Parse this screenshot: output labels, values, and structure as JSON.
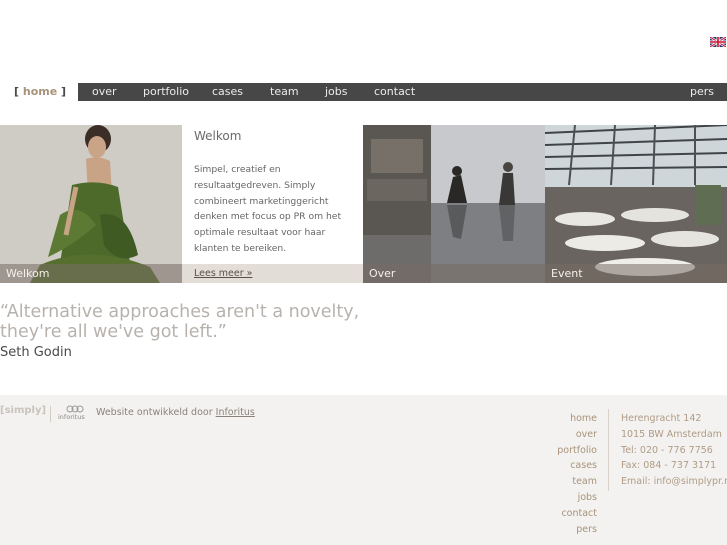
{
  "header": {
    "flag_icon": "uk-flag-icon"
  },
  "nav": {
    "home_bracket_open": "[",
    "home": "home",
    "home_bracket_close": "]",
    "items": [
      "over",
      "portfolio",
      "cases",
      "team",
      "jobs",
      "contact"
    ],
    "pers": "pers"
  },
  "panels": {
    "welkom_caption": "Welkom",
    "welkom_title": "Welkom",
    "welkom_text": "Simpel, creatief en resultaatgedreven. Simply combineert marketinggericht denken met focus op PR om het optimale resultaat voor haar klanten te bereiken.",
    "lees_meer": "Lees meer »",
    "over_caption": "Over",
    "event_caption": "Event"
  },
  "quote": {
    "line1": "“Alternative approaches aren't a novelty,",
    "line2": "they're all we've got left.”",
    "author": "Seth Godin"
  },
  "footer": {
    "logo": "[simply]",
    "inforitus_logo": "inforitus",
    "credit": "Website ontwikkeld door ",
    "credit_link": "Inforitus",
    "nav": [
      "home",
      "over",
      "portfolio",
      "cases",
      "team",
      "jobs",
      "contact",
      "pers"
    ],
    "address": [
      "Herengracht 142",
      "1015 BW Amsterdam",
      "Tel: 020 - 776 7756",
      "Fax: 084 - 737 3171",
      "Email: info@simplypr.nl"
    ]
  },
  "colors": {
    "accent": "#a8937a",
    "nav_bg": "#474747",
    "footer_bg": "#f3f2f0"
  }
}
